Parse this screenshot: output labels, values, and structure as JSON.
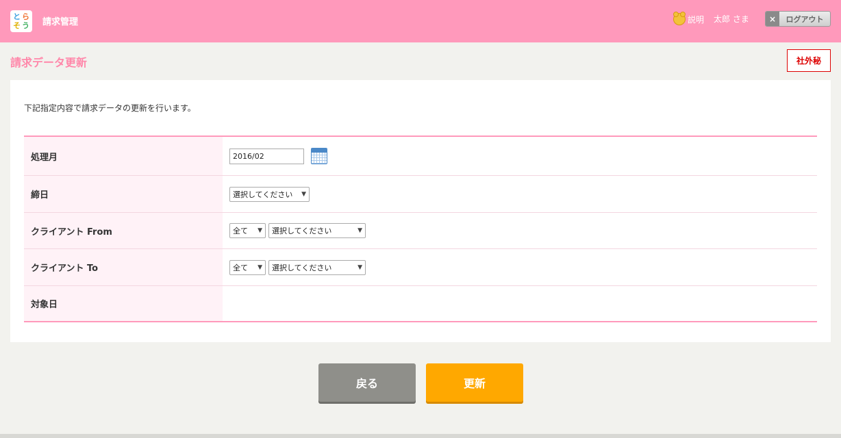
{
  "header": {
    "logo_chars": [
      "と",
      "ら",
      "そ",
      "う"
    ],
    "app_title": "請求管理",
    "help_label": "説明",
    "user_name": "太郎 さま",
    "logout_label": "ログアウト",
    "logout_x": "×"
  },
  "page": {
    "title": "請求データ更新",
    "confidential_label": "社外秘",
    "description": "下記指定内容で請求データの更新を行います。"
  },
  "form": {
    "rows": [
      {
        "label": "処理月"
      },
      {
        "label": "締日"
      },
      {
        "label": "クライアント From"
      },
      {
        "label": "クライアント To"
      },
      {
        "label": "対象日"
      }
    ],
    "processing_month": "2016/02",
    "closing_day_select": "選択してください",
    "client_from_scope": "全て",
    "client_from_select": "選択してください",
    "client_to_scope": "全て",
    "client_to_select": "選択してください"
  },
  "buttons": {
    "back_label": "戻る",
    "update_label": "更新"
  },
  "colors": {
    "header_bg": "#ff99bb",
    "title": "#ff88aa",
    "confidential": "#dd0000",
    "back_button": "#8f8f8a",
    "update_button": "#ffa800"
  }
}
